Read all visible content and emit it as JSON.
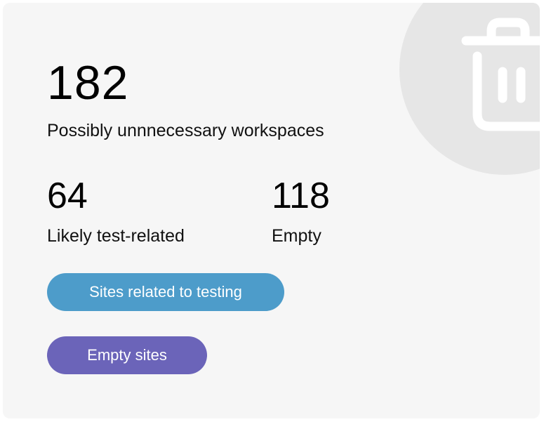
{
  "summary": {
    "total_count": "182",
    "total_label": "Possibly unnnecessary workspaces"
  },
  "stats": {
    "test_related": {
      "count": "64",
      "label": "Likely test-related"
    },
    "empty": {
      "count": "118",
      "label": "Empty"
    }
  },
  "buttons": {
    "testing_label": "Sites related to testing",
    "empty_label": "Empty sites"
  },
  "colors": {
    "card_background": "#f6f6f6",
    "decor_circle": "#e6e6e6",
    "testing_button": "#4d9cca",
    "empty_button": "#6b64b9"
  },
  "icons": {
    "decor": "trash-icon"
  }
}
